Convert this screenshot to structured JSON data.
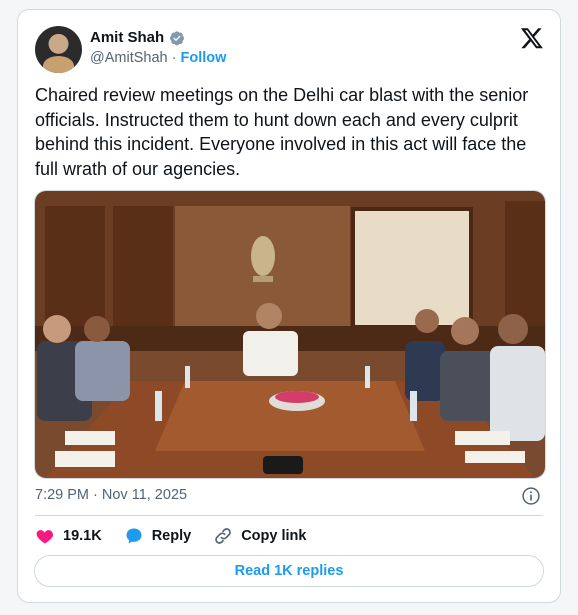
{
  "author": {
    "name": "Amit Shah",
    "handle": "@AmitShah",
    "separator": "·",
    "follow_label": "Follow"
  },
  "tweet": {
    "text": "Chaired review meetings on the Delhi car blast with the senior officials. Instructed them to hunt down each and every culprit behind this incident. Everyone involved in this act will face the full wrath of our agencies."
  },
  "meta": {
    "timestamp": "7:29 PM · Nov 11, 2025"
  },
  "actions": {
    "likes": "19.1K",
    "reply_label": "Reply",
    "copy_link_label": "Copy link"
  },
  "replies_button": "Read 1K replies",
  "colors": {
    "accent": "#1d9bf0",
    "like": "#f91880",
    "muted": "#536471",
    "border": "#cfd9de"
  },
  "icons": [
    "verified-badge-icon",
    "x-logo-icon",
    "info-icon",
    "heart-icon",
    "reply-bubble-icon",
    "link-icon"
  ]
}
